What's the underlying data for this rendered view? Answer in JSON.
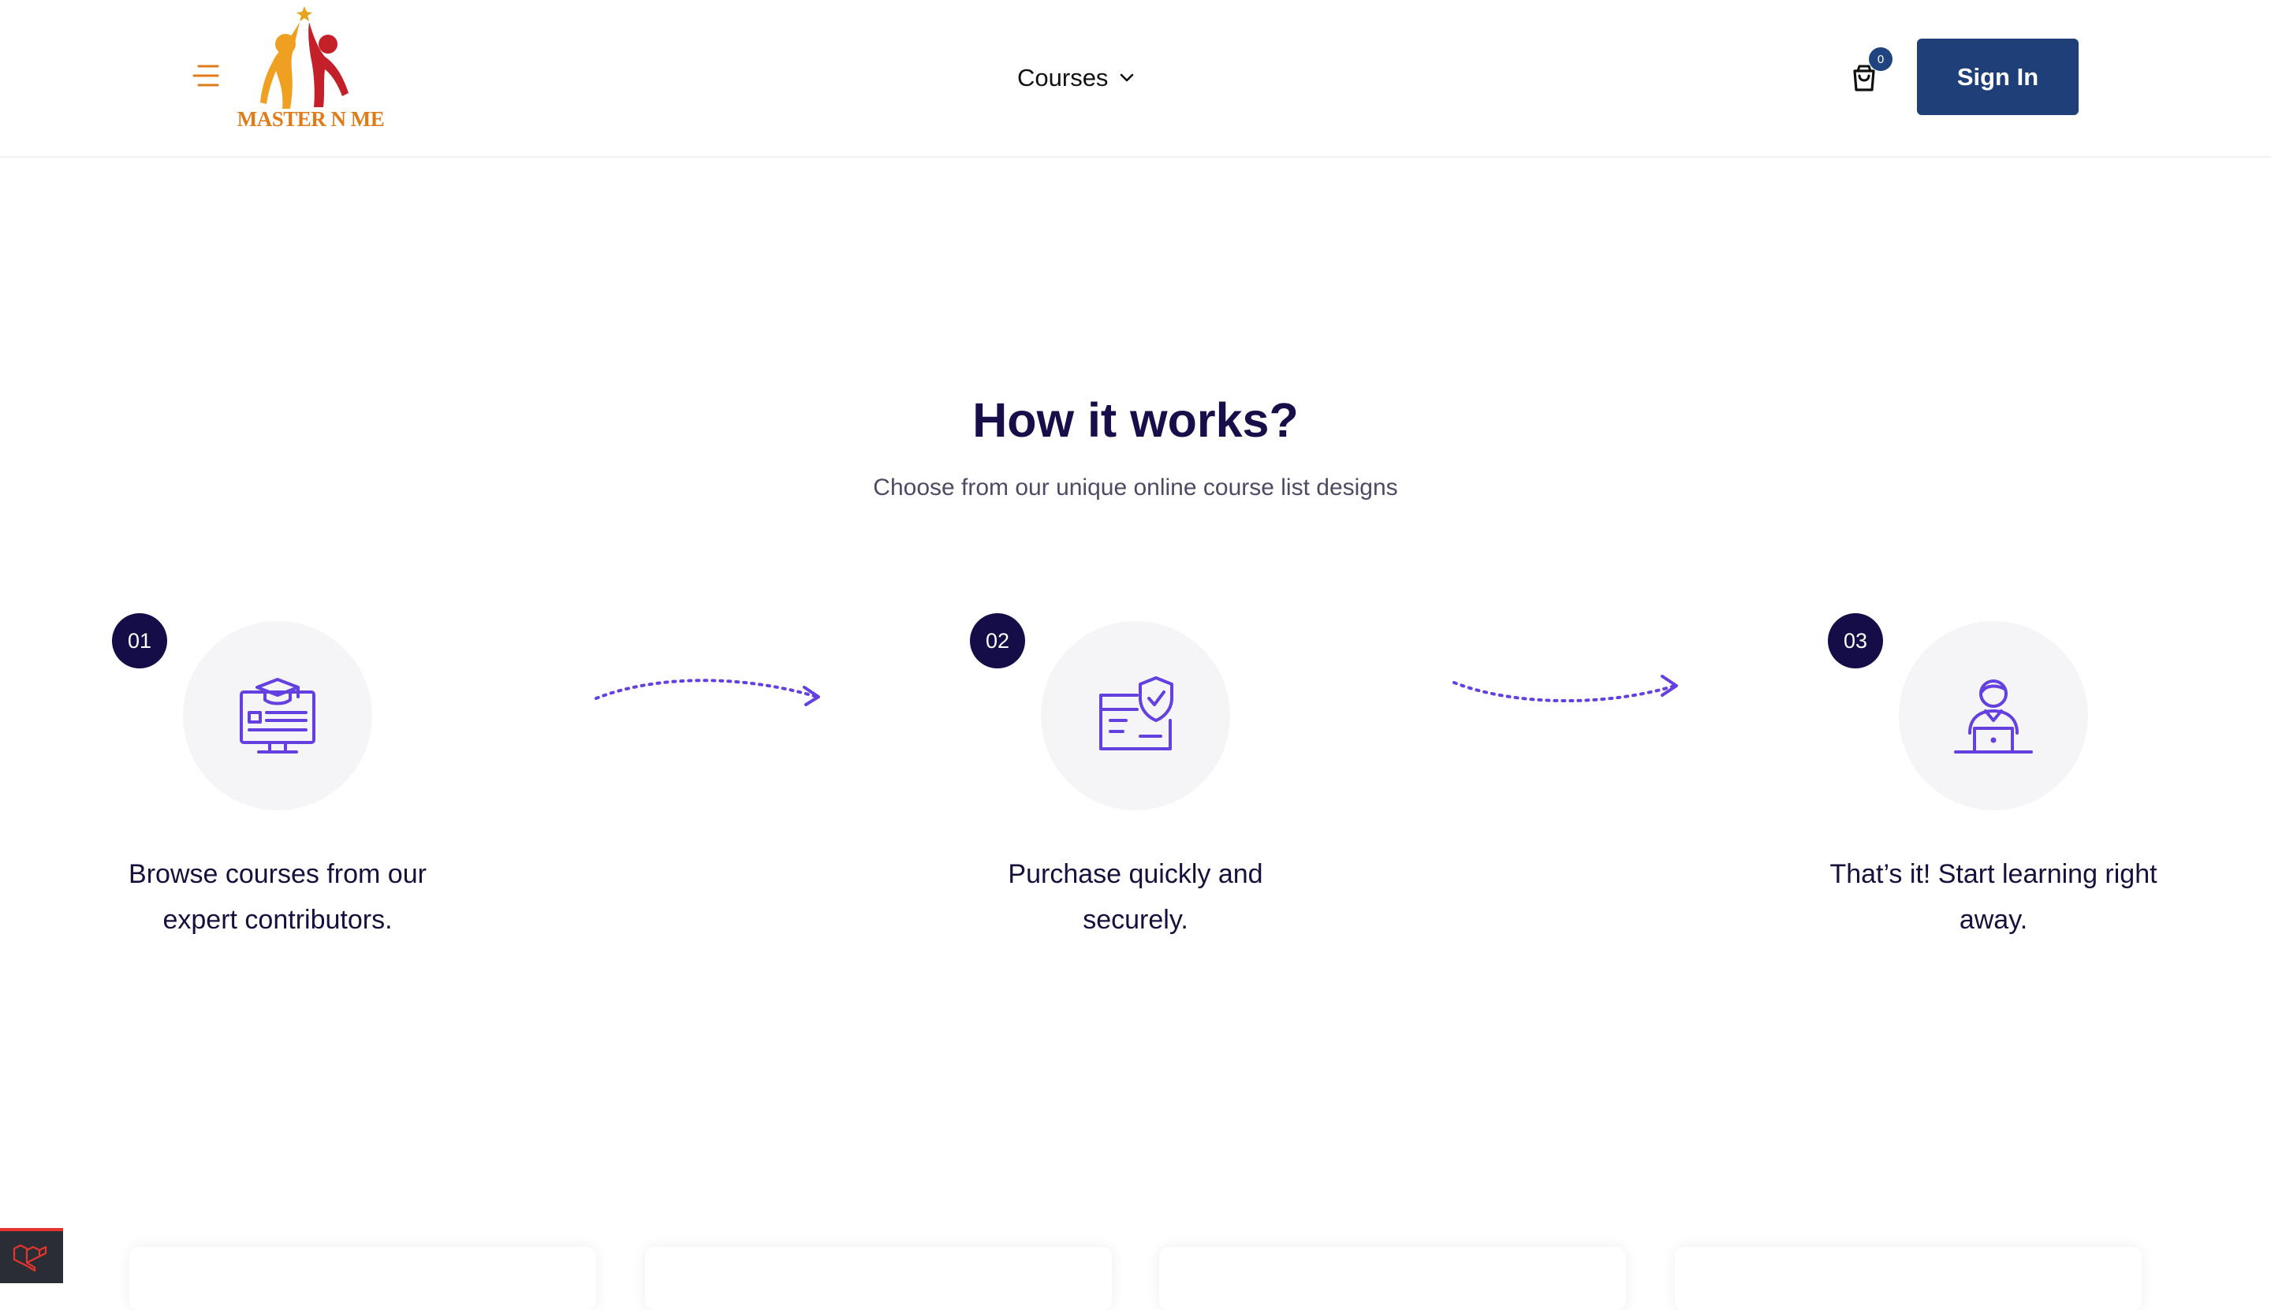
{
  "header": {
    "logo_text": "MASTER N ME",
    "nav_courses_label": "Courses",
    "cart_count": "0",
    "signin_label": "Sign In",
    "icons": {
      "menu": "hamburger-menu-icon",
      "dropdown": "chevron-down-icon",
      "cart": "shopping-bag-icon"
    },
    "colors": {
      "signin_bg": "#1f3f78",
      "logo_text": "#e07b1a"
    }
  },
  "how_it_works": {
    "title": "How it works?",
    "subtitle": "Choose from our unique online course list designs",
    "steps": [
      {
        "number": "01",
        "text": "Browse courses from our expert contributors.",
        "icon": "online-course-screen-icon"
      },
      {
        "number": "02",
        "text": "Purchase quickly and securely.",
        "icon": "secure-payment-card-icon"
      },
      {
        "number": "03",
        "text": "That’s it! Start learning right away.",
        "icon": "learner-at-laptop-icon"
      }
    ],
    "colors": {
      "accent": "#6440e0",
      "number_badge": "#150d48"
    }
  },
  "debug_toolbar": {
    "icon": "laravel-logo-icon",
    "color": "#e3342f"
  }
}
